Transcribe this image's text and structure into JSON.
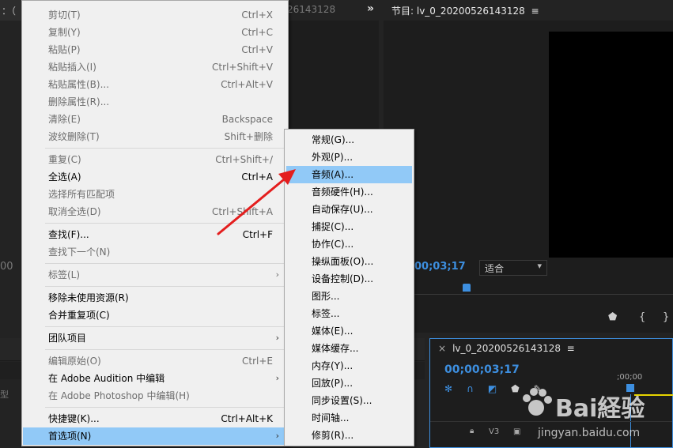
{
  "background": {
    "left_tab_fragment": "：（",
    "source_title": "26143128",
    "source_more_icon": "double-chevron-right-icon",
    "program_title": "节目: lv_0_20200526143128",
    "program_menu_icon": "hamburger-icon",
    "left_timecode": "00",
    "program_timecode": "00;03;17",
    "fit_select": {
      "value": "适合",
      "chevron": "▾"
    },
    "transport_icons": [
      "marker-icon",
      "in-point-icon",
      "out-point-icon"
    ],
    "timeline": {
      "tab_close": "×",
      "tab_label": "lv_0_20200526143128",
      "tab_menu_icon": "hamburger-icon",
      "timecode": "00;00;03;17",
      "ruler_timecode": ";00;00",
      "track_label": "V3",
      "tool_icons": [
        "nest-icon",
        "snap-magnet-icon",
        "linked-selection-icon",
        "add-marker-icon",
        "settings-wrench-icon"
      ]
    }
  },
  "menu": {
    "items": [
      {
        "label": "剪切(T)",
        "shortcut": "Ctrl+X",
        "disabled": true
      },
      {
        "label": "复制(Y)",
        "shortcut": "Ctrl+C",
        "disabled": true
      },
      {
        "label": "粘贴(P)",
        "shortcut": "Ctrl+V",
        "disabled": true
      },
      {
        "label": "粘贴插入(I)",
        "shortcut": "Ctrl+Shift+V",
        "disabled": true
      },
      {
        "label": "粘贴属性(B)...",
        "shortcut": "Ctrl+Alt+V",
        "disabled": true
      },
      {
        "label": "删除属性(R)...",
        "shortcut": "",
        "disabled": true
      },
      {
        "label": "清除(E)",
        "shortcut": "Backspace",
        "disabled": true
      },
      {
        "label": "波纹删除(T)",
        "shortcut": "Shift+删除",
        "disabled": true
      },
      {
        "label": "重复(C)",
        "shortcut": "Ctrl+Shift+/",
        "disabled": true
      },
      {
        "label": "全选(A)",
        "shortcut": "Ctrl+A",
        "disabled": false
      },
      {
        "label": "选择所有匹配项",
        "shortcut": "",
        "disabled": true
      },
      {
        "label": "取消全选(D)",
        "shortcut": "Ctrl+Shift+A",
        "disabled": true
      },
      {
        "label": "查找(F)...",
        "shortcut": "Ctrl+F",
        "disabled": false
      },
      {
        "label": "查找下一个(N)",
        "shortcut": "",
        "disabled": true
      },
      {
        "label": "标签(L)",
        "shortcut": "",
        "disabled": true
      },
      {
        "label": "移除未使用资源(R)",
        "shortcut": "",
        "disabled": false
      },
      {
        "label": "合并重复项(C)",
        "shortcut": "",
        "disabled": false
      },
      {
        "label": "团队项目",
        "shortcut": "",
        "disabled": false
      },
      {
        "label": "编辑原始(O)",
        "shortcut": "Ctrl+E",
        "disabled": true
      },
      {
        "label": "在 Adobe Audition 中编辑",
        "shortcut": "",
        "disabled": false
      },
      {
        "label": "在 Adobe Photoshop 中编辑(H)",
        "shortcut": "",
        "disabled": true
      },
      {
        "label": "快捷键(K)...",
        "shortcut": "Ctrl+Alt+K",
        "disabled": false
      },
      {
        "label": "首选项(N)",
        "shortcut": "",
        "disabled": false,
        "highlighted": true
      }
    ],
    "submenu_arrow": "›"
  },
  "submenu": {
    "items": [
      {
        "label": "常规(G)..."
      },
      {
        "label": "外观(P)..."
      },
      {
        "label": "音频(A)...",
        "highlighted": true
      },
      {
        "label": "音频硬件(H)..."
      },
      {
        "label": "自动保存(U)..."
      },
      {
        "label": "捕捉(C)..."
      },
      {
        "label": "协作(C)..."
      },
      {
        "label": "操纵面板(O)..."
      },
      {
        "label": "设备控制(D)..."
      },
      {
        "label": "图形..."
      },
      {
        "label": "标签..."
      },
      {
        "label": "媒体(E)..."
      },
      {
        "label": "媒体缓存..."
      },
      {
        "label": "内存(Y)..."
      },
      {
        "label": "回放(P)..."
      },
      {
        "label": "同步设置(S)..."
      },
      {
        "label": "时间轴..."
      },
      {
        "label": "修剪(R)..."
      }
    ]
  },
  "annotation": {
    "arrow_color": "#e41e1e",
    "icon": "red-pointer-arrow-icon"
  },
  "watermark": {
    "brand": "Bai経验",
    "url": "jingyan.baidu.com",
    "icon": "baidu-paw-icon"
  },
  "colors": {
    "highlight": "#91c9f7",
    "accent": "#3d8fe0",
    "menu_bg": "#f0f0f0"
  }
}
